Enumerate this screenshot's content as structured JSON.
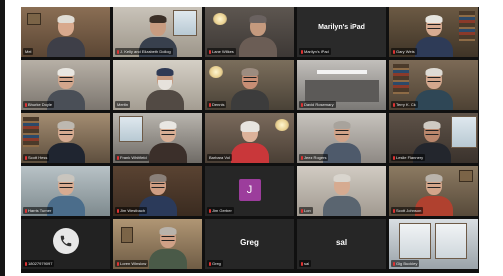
{
  "app": {
    "name": "Zoom gallery view"
  },
  "participants": [
    {
      "name": "Mel",
      "kind": "video"
    },
    {
      "name": "J. Kelly and Elizabeth Dollog",
      "kind": "video"
    },
    {
      "name": "Lane Wilkes",
      "kind": "video"
    },
    {
      "name": "Marilyn's iPad",
      "kind": "name_only",
      "display": "Marilyn's iPad"
    },
    {
      "name": "Gary Weis",
      "kind": "video"
    },
    {
      "name": "Bhurke Doyle",
      "kind": "video"
    },
    {
      "name": "Mertin",
      "kind": "video"
    },
    {
      "name": "Dennis",
      "kind": "video"
    },
    {
      "name": "David Rosemary",
      "kind": "video"
    },
    {
      "name": "Terry K. Ck",
      "kind": "video"
    },
    {
      "name": "Scott Hess",
      "kind": "video"
    },
    {
      "name": "Frank Whitfield",
      "kind": "video"
    },
    {
      "name": "Barbara Vol",
      "kind": "video",
      "active": true
    },
    {
      "name": "Jeez Rogers",
      "kind": "video"
    },
    {
      "name": "Leslie Flannery",
      "kind": "video"
    },
    {
      "name": "Harris Turner",
      "kind": "video"
    },
    {
      "name": "Jim Westbach",
      "kind": "video"
    },
    {
      "name": "Jim Gerber",
      "kind": "avatar",
      "initial": "J"
    },
    {
      "name": "Lon",
      "kind": "video"
    },
    {
      "name": "Scott Johnson",
      "kind": "video"
    },
    {
      "name": "18027979097",
      "kind": "phone"
    },
    {
      "name": "Loren Winslow",
      "kind": "video"
    },
    {
      "name": "Greg",
      "kind": "name_only",
      "display": "Greg"
    },
    {
      "name": "sal",
      "kind": "name_only",
      "display": "sal"
    },
    {
      "name": "Gig Buckley",
      "kind": "video"
    }
  ],
  "icons": {
    "phone": "phone-icon",
    "mic_muted": "mic-muted-icon"
  },
  "colors": {
    "active_speaker": "#e4d53c",
    "avatar_j": "#9c3d9c",
    "tile_bg": "#2b2b2b"
  }
}
